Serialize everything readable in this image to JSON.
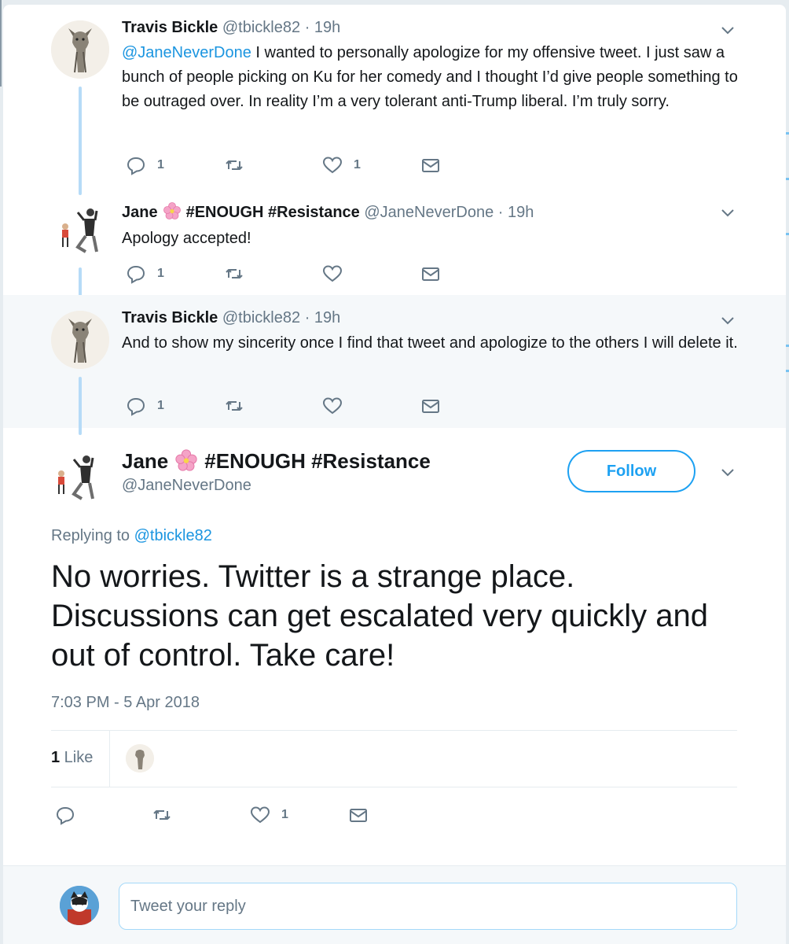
{
  "thread": [
    {
      "display_name": "Travis Bickle",
      "handle": "@tbickle82",
      "time": "· 19h",
      "text_mention": "@JaneNeverDone",
      "text": " I wanted to personally apologize for my offensive tweet. I just saw a bunch of people picking on Ku for her comedy and I thought I’d give people something to be outraged over. In reality I’m a very tolerant anti-Trump liberal. I’m truly sorry.",
      "reply_count": "1",
      "like_count": "1"
    },
    {
      "display_name_first": "Jane",
      "display_name_rest": "#ENOUGH #Resistance",
      "handle": "@JaneNeverDone",
      "time": "· 19h",
      "text": "Apology accepted!",
      "reply_count": "1"
    },
    {
      "display_name": "Travis Bickle",
      "handle": "@tbickle82",
      "time": "· 19h",
      "text": "And to show my sincerity once I find that tweet and apologize to the others I will delete it.",
      "reply_count": "1"
    }
  ],
  "main_tweet": {
    "display_name_first": "Jane",
    "display_name_rest": "#ENOUGH #Resistance",
    "handle": "@JaneNeverDone",
    "follow_label": "Follow",
    "replying_prefix": "Replying to ",
    "replying_handle": "@tbickle82",
    "text": "No worries. Twitter is a strange place. Discussions can get escalated very quickly and out of control. Take care!",
    "timestamp": "7:03 PM - 5 Apr 2018",
    "likes_count": "1",
    "likes_label": " Like",
    "like_count": "1"
  },
  "reply_box": {
    "placeholder": "Tweet your reply"
  },
  "colors": {
    "accent": "#1da1f2",
    "mention": "#1b95e0",
    "muted": "#657786",
    "thread_line": "#b6dbf7"
  }
}
